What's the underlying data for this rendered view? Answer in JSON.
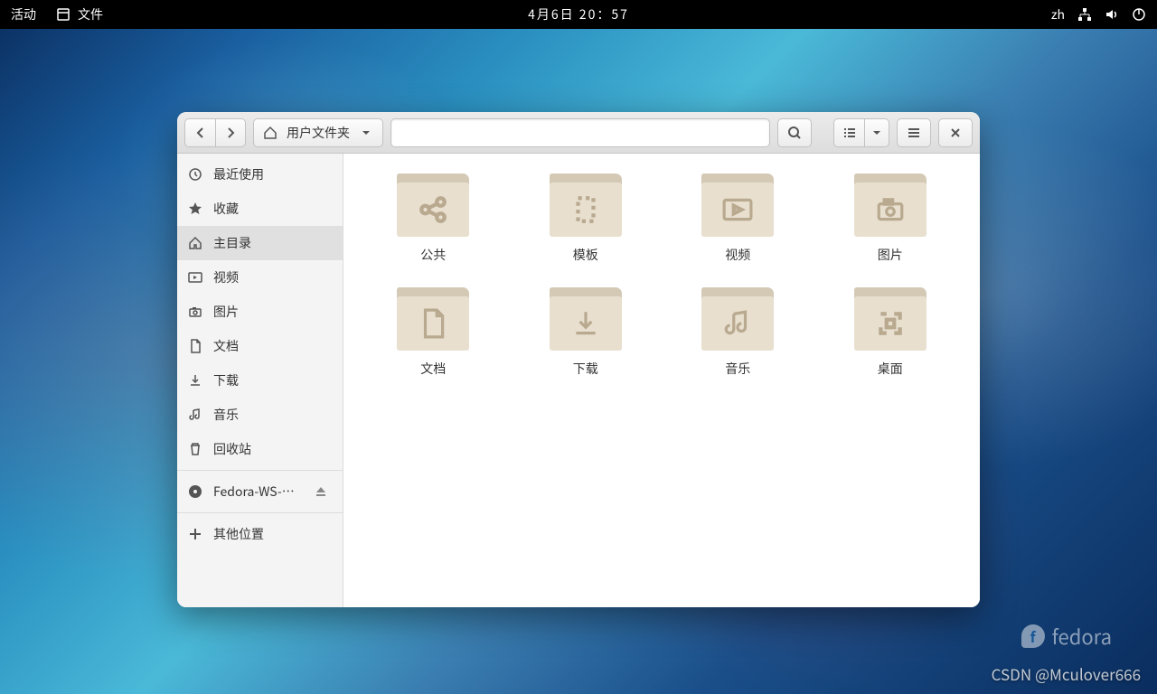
{
  "topbar": {
    "activities": "活动",
    "app_name": "文件",
    "datetime": "4月6日 20：57",
    "input_method": "zh"
  },
  "window": {
    "path_label": "用户文件夹"
  },
  "sidebar": {
    "items": [
      {
        "label": "最近使用",
        "icon": "clock"
      },
      {
        "label": "收藏",
        "icon": "star"
      },
      {
        "label": "主目录",
        "icon": "home",
        "active": true
      },
      {
        "label": "视频",
        "icon": "video"
      },
      {
        "label": "图片",
        "icon": "camera"
      },
      {
        "label": "文档",
        "icon": "document"
      },
      {
        "label": "下载",
        "icon": "download"
      },
      {
        "label": "音乐",
        "icon": "music"
      },
      {
        "label": "回收站",
        "icon": "trash"
      }
    ],
    "disk": {
      "label": "Fedora-WS-L…"
    },
    "other": {
      "label": "其他位置"
    }
  },
  "folders": [
    {
      "label": "公共",
      "icon": "share"
    },
    {
      "label": "模板",
      "icon": "template"
    },
    {
      "label": "视频",
      "icon": "video"
    },
    {
      "label": "图片",
      "icon": "camera"
    },
    {
      "label": "文档",
      "icon": "document"
    },
    {
      "label": "下载",
      "icon": "download"
    },
    {
      "label": "音乐",
      "icon": "music"
    },
    {
      "label": "桌面",
      "icon": "desktop"
    }
  ],
  "branding": {
    "distro": "fedora",
    "watermark": "CSDN @Mculover666"
  }
}
